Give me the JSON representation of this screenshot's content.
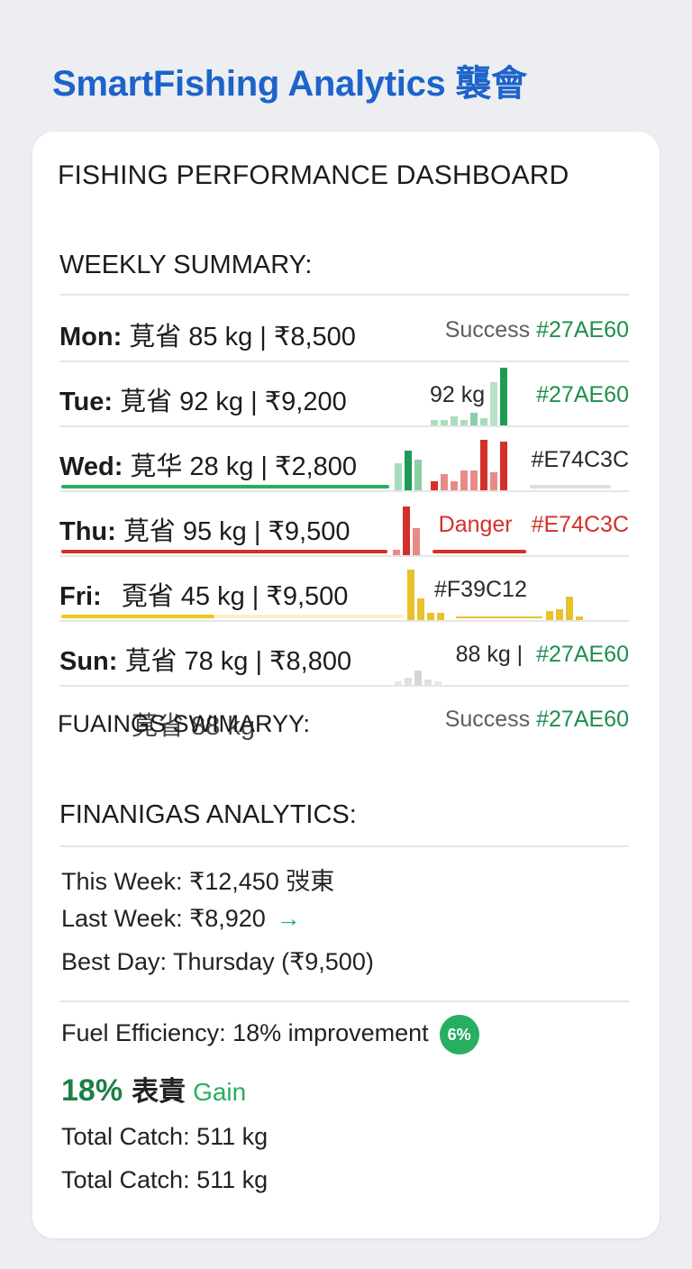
{
  "header": {
    "app_title": "SmartFishing Analytics 襲會"
  },
  "dashboard": {
    "title": "FISHING PERFORMANCE DASHBOARD",
    "weekly_title": "WEEKLY SUMMARY:",
    "rows": [
      {
        "day": "Mon:",
        "text": "莧省 85 kg | ₹8,500",
        "status": "Success",
        "color": "#27AE60"
      },
      {
        "day": "Tue:",
        "text": "莧省 92 kg | ₹9,200",
        "note": "92 kg",
        "color": "#27AE60"
      },
      {
        "day": "Wed:",
        "text": "莧华 28 kg | ₹2,800",
        "color": "#E74C3C"
      },
      {
        "day": "Thu:",
        "text": "莧省 95 kg | ₹9,500",
        "status": "Danger",
        "color": "#E74C3C"
      },
      {
        "day": "Fri:",
        "text": "覔省 45 kg | ₹9,500",
        "color": "#F39C12"
      },
      {
        "day": "Sun:",
        "text": "莧省 78 kg | ₹8,800",
        "note": "88 kg |",
        "color": "#27AE60"
      },
      {
        "text": "莧省 88 kg",
        "overlay": "FUAINGS SWIMARYY:",
        "status": "Success",
        "color": "#27AE60"
      }
    ]
  },
  "finance": {
    "title": "FINANIGAS ANALYTICS:",
    "this_week": "This Week: ₹12,450 弢東",
    "last_week": "Last Week:  ₹8,920",
    "last_week_arrow": "→",
    "best_day": "Best Day: Thursday (₹9,500)",
    "fuel": "Fuel Efficiency: 18% improvement",
    "fuel_badge": "6%",
    "gain_value": "18%",
    "gain_cjk": "表責",
    "gain_label": "Gain",
    "total_catch_1": "Total Catch: 511 kg",
    "total_catch_2": "Total Catch: 511 kg"
  }
}
